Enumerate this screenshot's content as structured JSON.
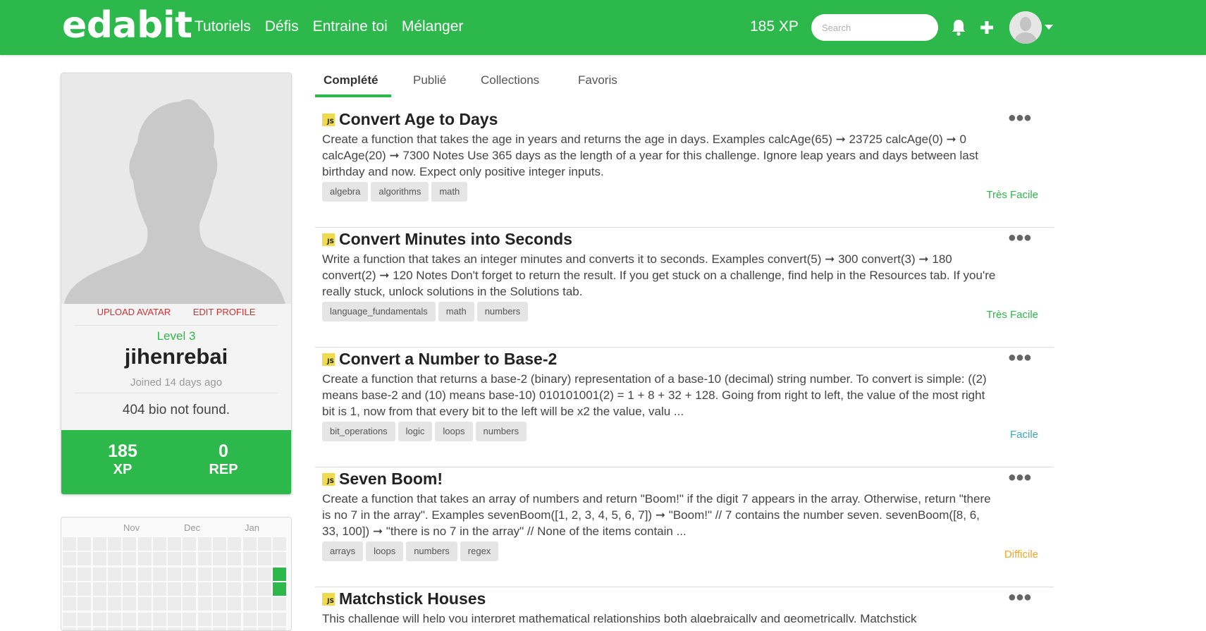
{
  "nav": {
    "brand": "edabit",
    "links": [
      "Tutoriels",
      "Défis",
      "Entraine toi",
      "Mélanger"
    ],
    "xp": "185 XP",
    "search_placeholder": "Search"
  },
  "profile": {
    "upload_avatar": "UPLOAD AVATAR",
    "edit_profile": "EDIT PROFILE",
    "level": "Level 3",
    "username": "jihenrebai",
    "joined": "Joined 14 days ago",
    "bio": "404 bio not found.",
    "stats": [
      {
        "value": "185",
        "label": "XP"
      },
      {
        "value": "0",
        "label": "REP"
      }
    ]
  },
  "activity": {
    "months": [
      "Nov",
      "Dec",
      "Jan"
    ]
  },
  "tabs": [
    "Complété",
    "Publié",
    "Collections",
    "Favoris"
  ],
  "challenges": [
    {
      "badge": "JS",
      "title": "Convert Age to Days",
      "description": "Create a function that takes the age in years and returns the age in days. Examples calcAge(65) ➞ 23725 calcAge(0) ➞ 0 calcAge(20) ➞ 7300 Notes Use 365 days as the length of a year for this challenge. Ignore leap years and days between last birthday and now. Expect only positive integer inputs.",
      "tags": [
        "algebra",
        "algorithms",
        "math"
      ],
      "difficulty": "Très Facile",
      "difficulty_color": "#2db84b"
    },
    {
      "badge": "JS",
      "title": "Convert Minutes into Seconds",
      "description": "Write a function that takes an integer minutes and converts it to seconds. Examples convert(5) ➞ 300 convert(3) ➞ 180 convert(2) ➞ 120 Notes Don't forget to return the result. If you get stuck on a challenge, find help in the Resources tab. If you're really stuck, unlock solutions in the Solutions tab.",
      "tags": [
        "language_fundamentals",
        "math",
        "numbers"
      ],
      "difficulty": "Très Facile",
      "difficulty_color": "#2db84b"
    },
    {
      "badge": "JS",
      "title": "Convert a Number to Base-2",
      "description": "Create a function that returns a base-2 (binary) representation of a base-10 (decimal) string number. To convert is simple: ((2) means base-2 and (10) means base-10) 010101001(2) = 1 + 8 + 32 + 128. Going from right to left, the value of the most right bit is 1, now from that every bit to the left will be x2 the value, valu ...",
      "tags": [
        "bit_operations",
        "logic",
        "loops",
        "numbers"
      ],
      "difficulty": "Facile",
      "difficulty_color": "#3aa9b5"
    },
    {
      "badge": "JS",
      "title": "Seven Boom!",
      "description": "Create a function that takes an array of numbers and return \"Boom!\" if the digit 7 appears in the array. Otherwise, return \"there is no 7 in the array\". Examples sevenBoom([1, 2, 3, 4, 5, 6, 7]) ➞ \"Boom!\" // 7 contains the number seven. sevenBoom([8, 6, 33, 100]) ➞ \"there is no 7 in the array\" // None of the items contain ...",
      "tags": [
        "arrays",
        "loops",
        "numbers",
        "regex"
      ],
      "difficulty": "Difficile",
      "difficulty_color": "#f5a623"
    },
    {
      "badge": "JS",
      "title": "Matchstick Houses",
      "description": "This challenge will help you interpret mathematical relationships both algebraically and geometrically. Matchstick",
      "tags": [],
      "difficulty": "",
      "difficulty_color": "#2db84b"
    }
  ]
}
